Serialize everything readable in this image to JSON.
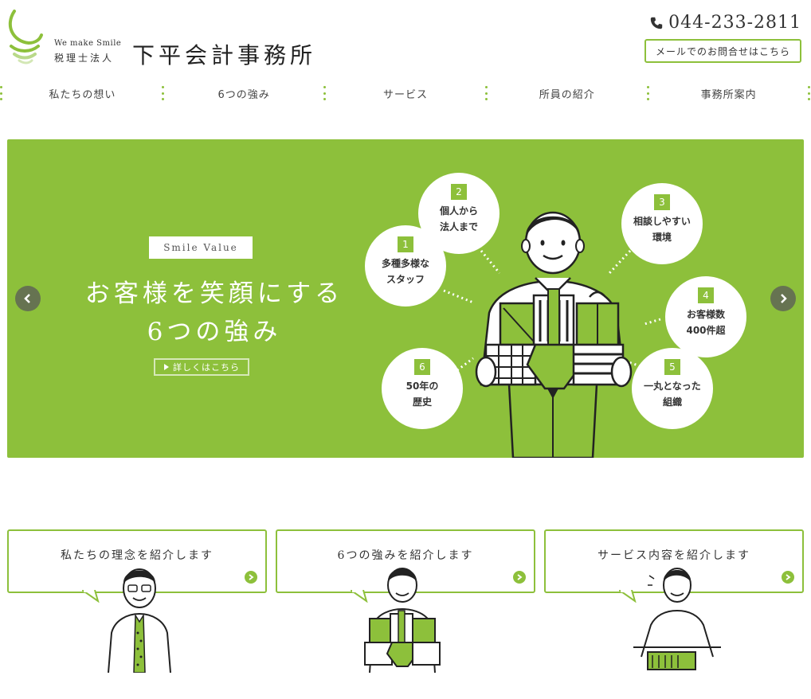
{
  "header": {
    "tagline": "We make Smile",
    "kind": "税理士法人",
    "name": "下平会計事務所",
    "phone": "044-233-2811",
    "mail_button": "メールでのお問合せはこちら"
  },
  "nav": {
    "items": [
      {
        "label": "私たちの想い"
      },
      {
        "label": "6つの強み"
      },
      {
        "label": "サービス"
      },
      {
        "label": "所員の紹介"
      },
      {
        "label": "事務所案内"
      }
    ]
  },
  "hero": {
    "badge": "Smile Value",
    "title_line1": "お客様を笑顔にする",
    "title_line2": "6つの強み",
    "detail_button": "詳しくはこちら",
    "strengths": [
      {
        "num": "1",
        "text": "多種多様な\nスタッフ"
      },
      {
        "num": "2",
        "text": "個人から\n法人まで"
      },
      {
        "num": "3",
        "text": "相談しやすい\n環境"
      },
      {
        "num": "4",
        "text": "お客様数\n400件超"
      },
      {
        "num": "5",
        "text": "一丸となった\n組織"
      },
      {
        "num": "6",
        "text": "50年の\n歴史"
      }
    ]
  },
  "cards": [
    {
      "title": "私たちの理念を紹介します"
    },
    {
      "title": "6つの強みを紹介します"
    },
    {
      "title": "サービス内容を紹介します"
    }
  ],
  "colors": {
    "accent": "#8dc03b",
    "text": "#333333"
  }
}
